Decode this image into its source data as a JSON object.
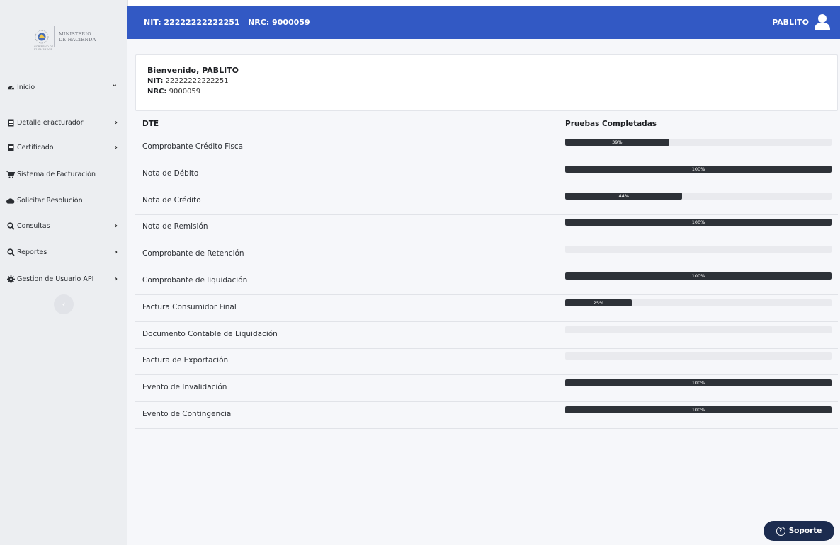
{
  "logo": {
    "line1": "MINISTERIO",
    "line2": "DE HACIENDA",
    "caption1": "GOBIERNO DE",
    "caption2": "EL SALVADOR"
  },
  "sidebar": {
    "items": [
      {
        "label": "Inicio",
        "icon": "dashboard-icon",
        "chevron": "⌄"
      },
      {
        "label": "Detalle eFacturador",
        "icon": "document-icon",
        "chevron": "›"
      },
      {
        "label": "Certificado",
        "icon": "document-icon",
        "chevron": "›"
      },
      {
        "label": "Sistema de Facturación",
        "icon": "cart-icon",
        "chevron": ""
      },
      {
        "label": "Solicitar Resolución",
        "icon": "cloud-icon",
        "chevron": ""
      },
      {
        "label": "Consultas",
        "icon": "search-icon",
        "chevron": "›"
      },
      {
        "label": "Reportes",
        "icon": "search-icon",
        "chevron": "›"
      },
      {
        "label": "Gestion de Usuario API",
        "icon": "gear-icon",
        "chevron": "›"
      }
    ],
    "collapse_glyph": "‹"
  },
  "header": {
    "ids": "NIT: 22222222222251   NRC: 9000059",
    "user": "PABLITO"
  },
  "welcome": {
    "greeting": "Bienvenido, PABLITO",
    "nit_label": "NIT:",
    "nit_value": " 22222222222251",
    "nrc_label": "NRC:",
    "nrc_value": " 9000059"
  },
  "table": {
    "headers": [
      "DTE",
      "Pruebas Completadas"
    ],
    "rows": [
      {
        "name": "Comprobante Crédito Fiscal",
        "progress": 39,
        "label": "39%"
      },
      {
        "name": "Nota de Débito",
        "progress": 100,
        "label": "100%"
      },
      {
        "name": "Nota de Crédito",
        "progress": 44,
        "label": "44%"
      },
      {
        "name": "Nota de Remisión",
        "progress": 100,
        "label": "100%"
      },
      {
        "name": "Comprobante de Retención",
        "progress": 0,
        "label": ""
      },
      {
        "name": "Comprobante de liquidación",
        "progress": 100,
        "label": "100%"
      },
      {
        "name": "Factura Consumidor Final",
        "progress": 25,
        "label": "25%"
      },
      {
        "name": "Documento Contable de Liquidación",
        "progress": 0,
        "label": ""
      },
      {
        "name": "Factura de Exportación",
        "progress": 0,
        "label": ""
      },
      {
        "name": "Evento de Invalidación",
        "progress": 100,
        "label": "100%"
      },
      {
        "name": "Evento de Contingencia",
        "progress": 100,
        "label": "100%"
      }
    ]
  },
  "support": {
    "label": "Soporte",
    "glyph": "?"
  },
  "colors": {
    "header": "#3259c4",
    "bar": "#2e3238",
    "support": "#1c2c4f"
  }
}
